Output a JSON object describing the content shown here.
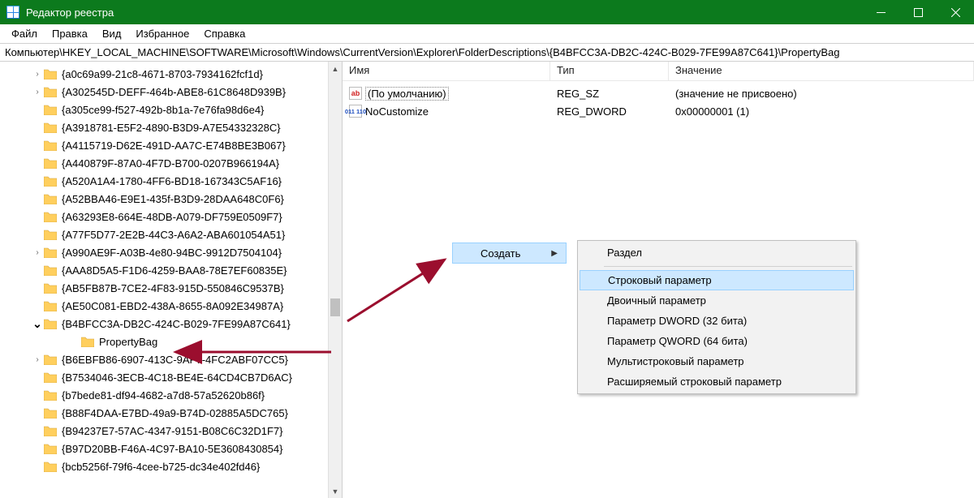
{
  "titlebar": {
    "title": "Редактор реестра"
  },
  "menu": {
    "file": "Файл",
    "edit": "Правка",
    "view": "Вид",
    "favorites": "Избранное",
    "help": "Справка"
  },
  "address": "Компьютер\\HKEY_LOCAL_MACHINE\\SOFTWARE\\Microsoft\\Windows\\CurrentVersion\\Explorer\\FolderDescriptions\\{B4BFCC3A-DB2C-424C-B029-7FE99A87C641}\\PropertyBag",
  "list": {
    "headers": {
      "name": "Имя",
      "type": "Тип",
      "value": "Значение"
    },
    "rows": [
      {
        "icon": "ab",
        "name": "(По умолчанию)",
        "default": true,
        "type": "REG_SZ",
        "value": "(значение не присвоено)"
      },
      {
        "icon": "bin",
        "name": "NoCustomize",
        "default": false,
        "type": "REG_DWORD",
        "value": "0x00000001 (1)"
      }
    ]
  },
  "tree": [
    {
      "expander": ">",
      "name": "{a0c69a99-21c8-4671-8703-7934162fcf1d}"
    },
    {
      "expander": ">",
      "name": "{A302545D-DEFF-464b-ABE8-61C8648D939B}"
    },
    {
      "expander": "",
      "name": "{a305ce99-f527-492b-8b1a-7e76fa98d6e4}"
    },
    {
      "expander": "",
      "name": "{A3918781-E5F2-4890-B3D9-A7E54332328C}"
    },
    {
      "expander": "",
      "name": "{A4115719-D62E-491D-AA7C-E74B8BE3B067}"
    },
    {
      "expander": "",
      "name": "{A440879F-87A0-4F7D-B700-0207B966194A}"
    },
    {
      "expander": "",
      "name": "{A520A1A4-1780-4FF6-BD18-167343C5AF16}"
    },
    {
      "expander": "",
      "name": "{A52BBA46-E9E1-435f-B3D9-28DAA648C0F6}"
    },
    {
      "expander": "",
      "name": "{A63293E8-664E-48DB-A079-DF759E0509F7}"
    },
    {
      "expander": "",
      "name": "{A77F5D77-2E2B-44C3-A6A2-ABA601054A51}"
    },
    {
      "expander": ">",
      "name": "{A990AE9F-A03B-4e80-94BC-9912D7504104}"
    },
    {
      "expander": "",
      "name": "{AAA8D5A5-F1D6-4259-BAA8-78E7EF60835E}"
    },
    {
      "expander": "",
      "name": "{AB5FB87B-7CE2-4F83-915D-550846C9537B}"
    },
    {
      "expander": "",
      "name": "{AE50C081-EBD2-438A-8655-8A092E34987A}"
    },
    {
      "expander": "v",
      "name": "{B4BFCC3A-DB2C-424C-B029-7FE99A87C641}"
    },
    {
      "expander": "",
      "name": "PropertyBag",
      "child": true
    },
    {
      "expander": ">",
      "name": "{B6EBFB86-6907-413C-9AF7-4FC2ABF07CC5}"
    },
    {
      "expander": "",
      "name": "{B7534046-3ECB-4C18-BE4E-64CD4CB7D6AC}"
    },
    {
      "expander": "",
      "name": "{b7bede81-df94-4682-a7d8-57a52620b86f}"
    },
    {
      "expander": "",
      "name": "{B88F4DAA-E7BD-49a9-B74D-02885A5DC765}"
    },
    {
      "expander": "",
      "name": "{B94237E7-57AC-4347-9151-B08C6C32D1F7}"
    },
    {
      "expander": "",
      "name": "{B97D20BB-F46A-4C97-BA10-5E3608430854}"
    },
    {
      "expander": "",
      "name": "{bcb5256f-79f6-4cee-b725-dc34e402fd46}"
    }
  ],
  "submenu": {
    "label": "Создать"
  },
  "cmenu": {
    "items": [
      {
        "label": "Раздел",
        "hi": false
      },
      {
        "sep": true
      },
      {
        "label": "Строковый параметр",
        "hi": true
      },
      {
        "label": "Двоичный параметр",
        "hi": false
      },
      {
        "label": "Параметр DWORD (32 бита)",
        "hi": false
      },
      {
        "label": "Параметр QWORD (64 бита)",
        "hi": false
      },
      {
        "label": "Мультистроковый параметр",
        "hi": false
      },
      {
        "label": "Расширяемый строковый параметр",
        "hi": false
      }
    ]
  }
}
